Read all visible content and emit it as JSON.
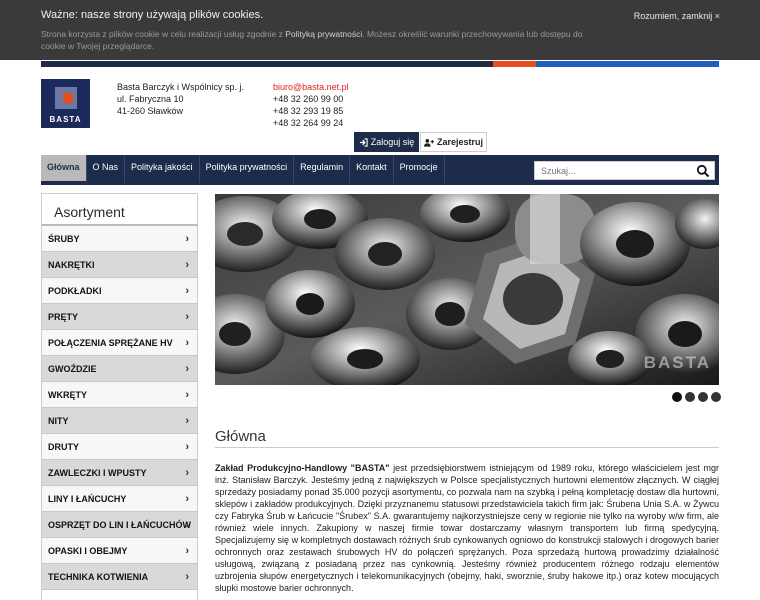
{
  "cookie": {
    "title": "Ważne: nasze strony używają plików cookies.",
    "text_before": "Strona korzysta z plików cookie w celu realizacji usług zgodnie z ",
    "policy_link": "Polityką prywatności",
    "text_after": ". Możesz określić warunki przechowywania lub dostępu do cookie w Twojej przeglądarce.",
    "close_label": "Rozumiem, zamknij ×"
  },
  "colors": {
    "navy": "#1d2c4a",
    "orange": "#e84e1b",
    "blue": "#1f5fbf",
    "email_red": "#d9261c"
  },
  "header": {
    "logo_text": "BASTA",
    "company_name": "Basta Barczyk i Wspólnicy sp. j.",
    "street": "ul. Fabryczna 10",
    "city": "41-260 Sławków",
    "email": "biuro@basta.net.pl",
    "phones": [
      "+48 32 260 99 00",
      "+48 32 293 19 85",
      "+48 32 264 99 24"
    ],
    "login_label": "Zaloguj się",
    "register_label": "Zarejestruj"
  },
  "nav": {
    "items": [
      "Główna",
      "O Nas",
      "Polityka jakości",
      "Polityka prywatności",
      "Regulamin",
      "Kontakt",
      "Promocje"
    ],
    "active": "Główna",
    "search_placeholder": "Szukaj..."
  },
  "sidebar": {
    "title": "Asortyment",
    "items": [
      "ŚRUBY",
      "NAKRĘTKI",
      "PODKŁADKI",
      "PRĘTY",
      "POŁĄCZENIA SPRĘŻANE HV",
      "GWOŹDZIE",
      "WKRĘTY",
      "NITY",
      "DRUTY",
      "ZAWLECZKI I WPUSTY",
      "LINY I ŁAŃCUCHY",
      "OSPRZĘT DO LIN I ŁAŃCUCHÓW",
      "OPASKI I OBEJMY",
      "TECHNIKA KOTWIENIA"
    ]
  },
  "slider": {
    "watermark": "BASTA",
    "slide_count": 4,
    "active_slide": 1
  },
  "main": {
    "title": "Główna",
    "intro_bold": "Zakład Produkcyjno-Handlowy \"BASTA\"",
    "intro_text": " jest przedsiębiorstwem istniejącym od 1989 roku, którego właścicielem jest mgr inż. Stanisław Barczyk. Jesteśmy jedną z największych w Polsce specjalistycznych hurtowni elementów złącznych. W ciągłej sprzedaży posiadamy ponad 35.000 pozycji asortymentu, co pozwala nam na szybką i pełną kompletację dostaw dla hurtowni, sklepów i zakładów produkcyjnych. Dzięki przyznanemu statusowi przedstawiciela takich firm jak: Śrubena Unia S.A. w Żywcu czy Fabryka Śrub w Łańcucie \"Śrubex\" S.A. gwarantujemy najkorzystniejsze ceny w regionie nie tylko na wyroby w/w firm, ale również wiele innych. Zakupiony w naszej firmie towar dostarczamy własnym transportem lub firmą spedycyjną. Specjalizujemy się w kompletnych dostawach różnych śrub cynkowanych ogniowo do konstrukcji stalowych i drogowych barier ochronnych oraz zestawach śrubowych HV do połączeń sprężanych. Poza sprzedażą hurtową prowadzimy działalność usługową, związaną z posiadaną przez nas cynkownią. Jesteśmy również producentem różnego rodzaju elementów uzbrojenia słupów energetycznych i telekomunikacyjnych (obejmy, haki, sworznie, śruby hakowe itp.) oraz kotew mocujących słupki mostowe barier ochronnych."
  }
}
